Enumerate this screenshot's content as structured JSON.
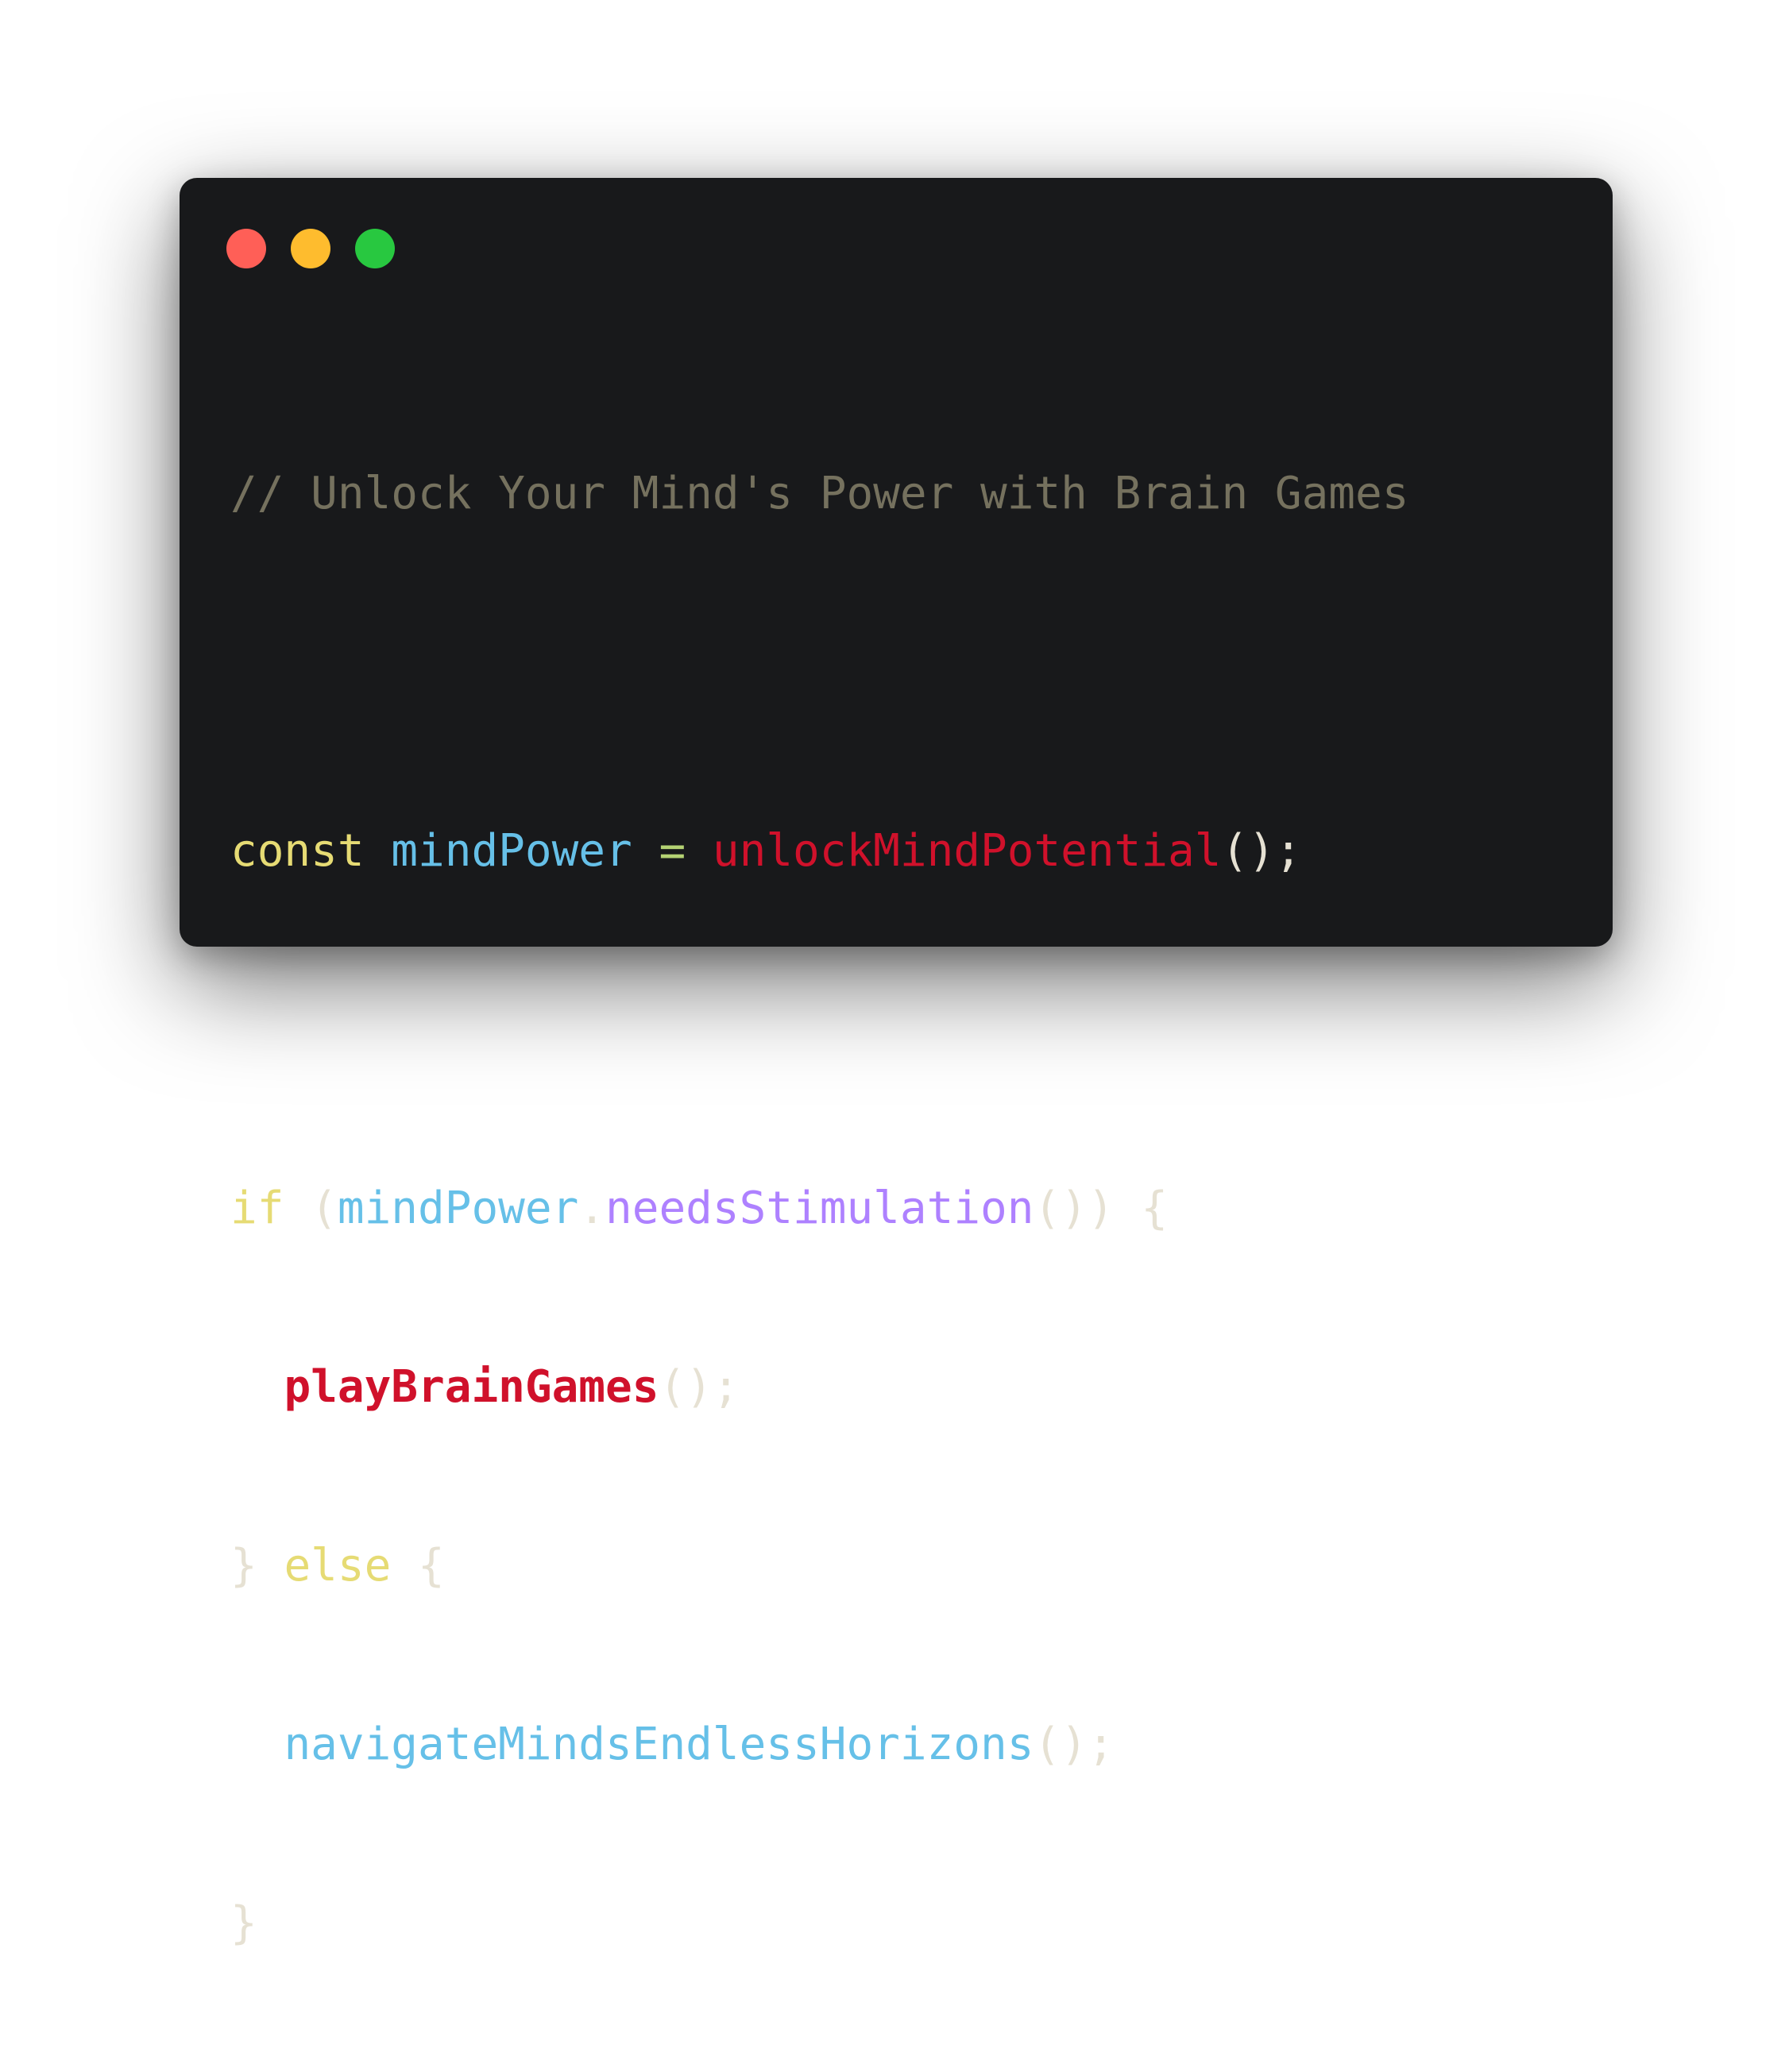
{
  "window": {
    "controls": [
      {
        "name": "close",
        "color": "#ff5f57"
      },
      {
        "name": "minimize",
        "color": "#febc2e"
      },
      {
        "name": "zoom",
        "color": "#28c840"
      }
    ]
  },
  "colors": {
    "background": "#18191b",
    "comment": "#75715e",
    "keyword": "#e6db74",
    "identifier": "#66c0e8",
    "operator": "#b4d273",
    "call_highlight": "#d0112b",
    "method": "#ae81ff",
    "punctuation": "#e6e1d3"
  },
  "code": {
    "comment": "// Unlock Your Mind's Power with Brain Games",
    "line1": {
      "kw": "const",
      "var": "mindPower",
      "op": "=",
      "fn": "unlockMindPotential",
      "tail": "();"
    },
    "line2": {
      "kw": "if",
      "open": "(",
      "obj": "mindPower",
      "dot": ".",
      "method": "needsStimulation",
      "tail": "()) {"
    },
    "line3": {
      "fn": "playBrainGames",
      "tail": "();"
    },
    "line4": {
      "brace": "}",
      "kw": "else",
      "open": "{"
    },
    "line5": {
      "fn": "navigateMindsEndlessHorizons",
      "tail": "();"
    },
    "line6": {
      "brace": "}"
    }
  }
}
